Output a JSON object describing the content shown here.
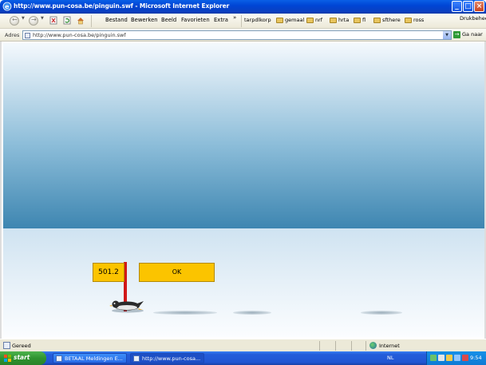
{
  "window": {
    "title": "http://www.pun-cosa.be/pinguin.swf - Microsoft Internet Explorer",
    "minimize_label": "_",
    "maximize_label": "□",
    "close_label": "×"
  },
  "toolbar": {
    "back_label": "←",
    "forward_label": "→",
    "menus": [
      "Bestand",
      "Bewerken",
      "Beeld",
      "Favorieten",
      "Extra"
    ],
    "overflow_chevron": "»",
    "links": [
      "tarpdlkorp",
      "gemaal",
      "nrf",
      "hrta",
      "fl",
      "sfthere",
      "ross"
    ],
    "print_label": "Drukbeheer"
  },
  "address_bar": {
    "label": "Adres",
    "value": "http://www.pun-cosa.be/pinguin.swf",
    "go_icon": "→",
    "go_label": "Ga naar"
  },
  "content": {
    "distance_value": "501.2",
    "ok_label": "OK"
  },
  "status_bar": {
    "status": "Gereed",
    "zone": "Internet"
  },
  "taskbar": {
    "start_label": "start",
    "items": [
      {
        "label": "BETAAL Meldingen E..."
      },
      {
        "label": "http://www.pun-cosa..."
      }
    ],
    "language": "NL",
    "clock": "9:54"
  },
  "colors": {
    "sign_yellow": "#fbc400",
    "pole_red": "#d11818",
    "sky_top": "#f4f9fd",
    "sky_bottom": "#3e86b1"
  }
}
